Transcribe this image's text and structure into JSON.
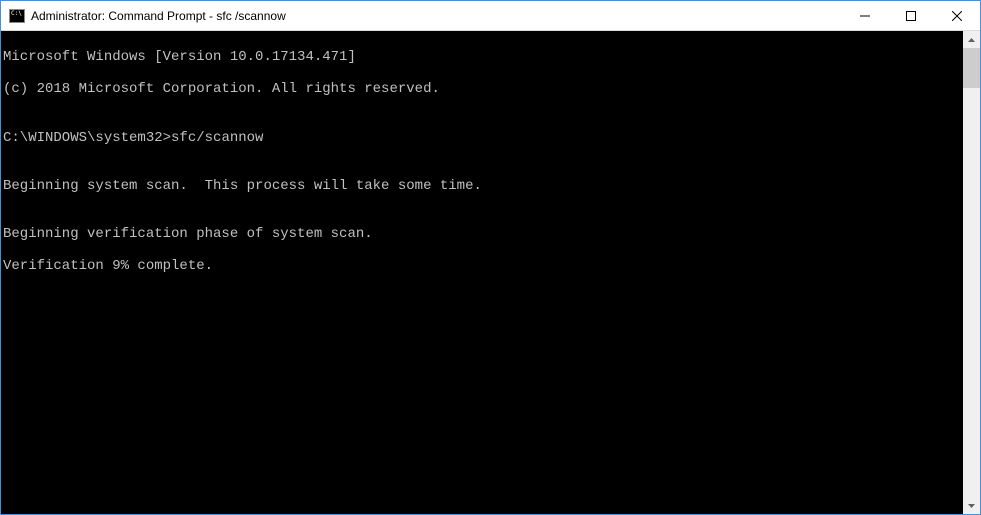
{
  "window": {
    "title": "Administrator: Command Prompt - sfc /scannow"
  },
  "console": {
    "line1": "Microsoft Windows [Version 10.0.17134.471]",
    "line2": "(c) 2018 Microsoft Corporation. All rights reserved.",
    "blank1": "",
    "prompt": "C:\\WINDOWS\\system32>",
    "command": "sfc/scannow",
    "blank2": "",
    "line3": "Beginning system scan.  This process will take some time.",
    "blank3": "",
    "line4": "Beginning verification phase of system scan.",
    "line5": "Verification 9% complete."
  }
}
